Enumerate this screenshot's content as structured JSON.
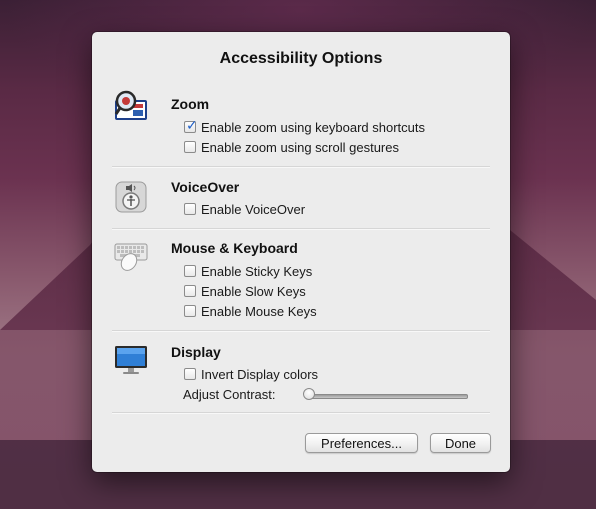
{
  "dialog": {
    "title": "Accessibility Options",
    "sections": [
      {
        "id": "zoom",
        "title": "Zoom",
        "icon": "zoom-magnifier-icon",
        "options": [
          {
            "label": "Enable zoom using keyboard shortcuts",
            "checked": true
          },
          {
            "label": "Enable zoom using scroll gestures",
            "checked": false
          }
        ]
      },
      {
        "id": "voiceover",
        "title": "VoiceOver",
        "icon": "voiceover-icon",
        "options": [
          {
            "label": "Enable VoiceOver",
            "checked": false
          }
        ]
      },
      {
        "id": "mouse-keyboard",
        "title": "Mouse & Keyboard",
        "icon": "keyboard-mouse-icon",
        "options": [
          {
            "label": "Enable Sticky Keys",
            "checked": false
          },
          {
            "label": "Enable Slow Keys",
            "checked": false
          },
          {
            "label": "Enable Mouse Keys",
            "checked": false
          }
        ]
      },
      {
        "id": "display",
        "title": "Display",
        "icon": "display-monitor-icon",
        "options": [
          {
            "label": "Invert Display colors",
            "checked": false
          }
        ],
        "contrast_label": "Adjust Contrast:",
        "contrast_value": 0
      }
    ],
    "buttons": {
      "preferences": "Preferences...",
      "done": "Done"
    }
  }
}
